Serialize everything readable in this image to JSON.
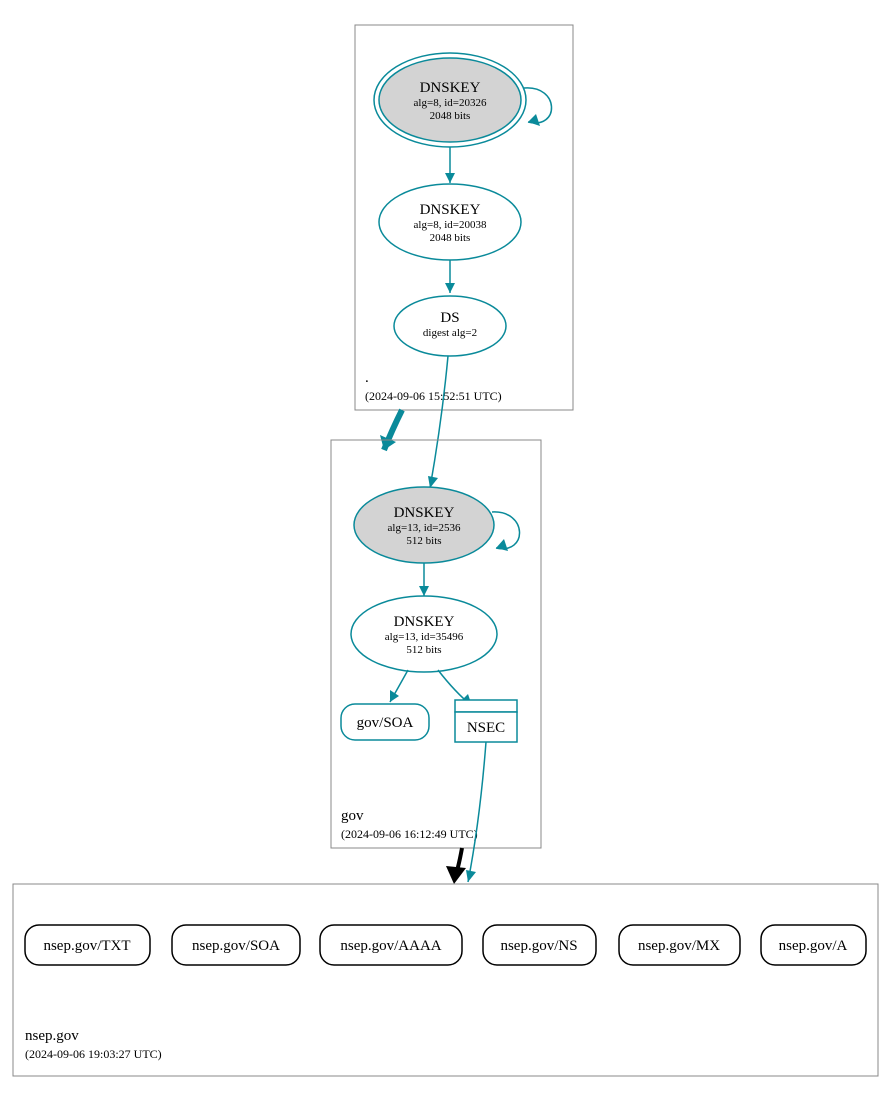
{
  "colors": {
    "teal": "#0a8a9a",
    "grayFill": "#d3d3d3",
    "boxStroke": "#888888"
  },
  "zones": {
    "root": {
      "label": ".",
      "timestamp": "(2024-09-06 15:52:51 UTC)"
    },
    "gov": {
      "label": "gov",
      "timestamp": "(2024-09-06 16:12:49 UTC)"
    },
    "nsep": {
      "label": "nsep.gov",
      "timestamp": "(2024-09-06 19:03:27 UTC)"
    }
  },
  "nodes": {
    "root_ksk": {
      "title": "DNSKEY",
      "line1": "alg=8, id=20326",
      "line2": "2048 bits"
    },
    "root_zsk": {
      "title": "DNSKEY",
      "line1": "alg=8, id=20038",
      "line2": "2048 bits"
    },
    "root_ds": {
      "title": "DS",
      "line1": "digest alg=2"
    },
    "gov_ksk": {
      "title": "DNSKEY",
      "line1": "alg=13, id=2536",
      "line2": "512 bits"
    },
    "gov_zsk": {
      "title": "DNSKEY",
      "line1": "alg=13, id=35496",
      "line2": "512 bits"
    },
    "gov_soa": {
      "title": "gov/SOA"
    },
    "gov_nsec": {
      "title": "NSEC"
    },
    "nsep_txt": {
      "title": "nsep.gov/TXT"
    },
    "nsep_soa": {
      "title": "nsep.gov/SOA"
    },
    "nsep_aaaa": {
      "title": "nsep.gov/AAAA"
    },
    "nsep_ns": {
      "title": "nsep.gov/NS"
    },
    "nsep_mx": {
      "title": "nsep.gov/MX"
    },
    "nsep_a": {
      "title": "nsep.gov/A"
    }
  }
}
